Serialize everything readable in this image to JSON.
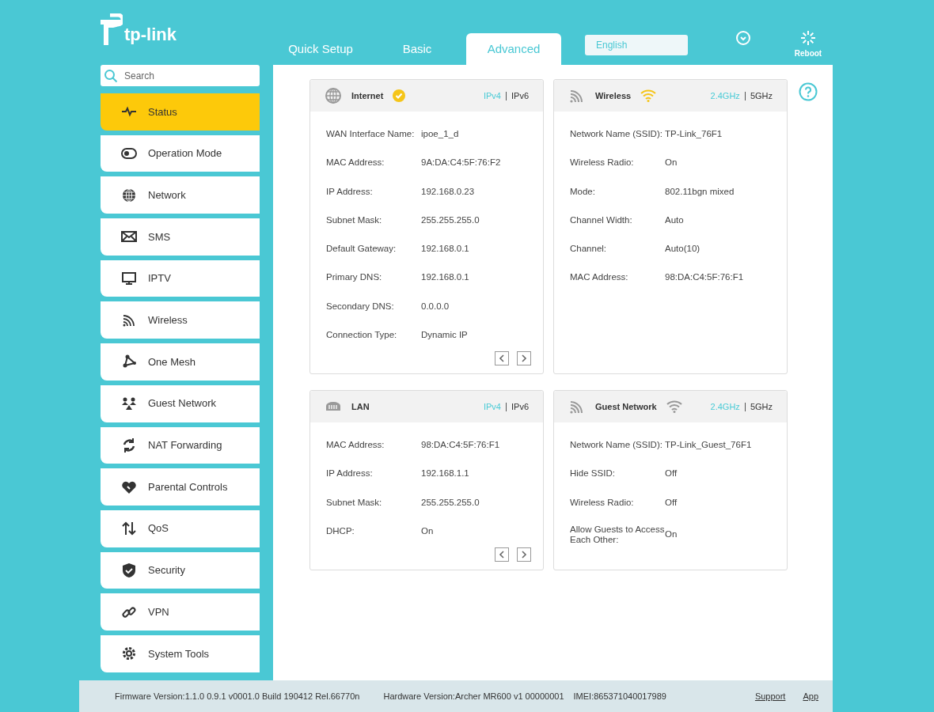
{
  "logo": {
    "text": "tp-link"
  },
  "tabs": [
    {
      "label": "Quick Setup",
      "selected": false
    },
    {
      "label": "Basic",
      "selected": false
    },
    {
      "label": "Advanced",
      "selected": true
    }
  ],
  "language": {
    "value": "English"
  },
  "header_actions": [
    {
      "kind": "logout"
    },
    {
      "kind": "reboot",
      "label": "Reboot"
    }
  ],
  "search": {
    "placeholder": "Search"
  },
  "sidebar": {
    "items": [
      {
        "kind": "status",
        "label": "Status",
        "selected": true
      },
      {
        "kind": "mode",
        "label": "Operation Mode",
        "selected": false
      },
      {
        "kind": "globe",
        "label": "Network",
        "selected": false
      },
      {
        "kind": "mail",
        "label": "SMS",
        "selected": false
      },
      {
        "kind": "monitor",
        "label": "IPTV",
        "selected": false
      },
      {
        "kind": "wifi",
        "label": "Wireless",
        "selected": false
      },
      {
        "kind": "mesh",
        "label": "One Mesh",
        "selected": false
      },
      {
        "kind": "guests",
        "label": "Guest Network",
        "selected": false
      },
      {
        "kind": "nat",
        "label": "NAT Forwarding",
        "selected": false
      },
      {
        "kind": "heart",
        "label": "Parental Controls",
        "selected": false
      },
      {
        "kind": "qos",
        "label": "QoS",
        "selected": false
      },
      {
        "kind": "shield",
        "label": "Security",
        "selected": false
      },
      {
        "kind": "link",
        "label": "VPN",
        "selected": false
      },
      {
        "kind": "gear",
        "label": "System Tools",
        "selected": false
      }
    ]
  },
  "cards": [
    {
      "kind": "internet",
      "title": "Internet",
      "connected": true,
      "options": [
        {
          "label": "IPv4",
          "selected": true
        },
        {
          "label": "IPv6",
          "selected": false
        }
      ],
      "pager": true,
      "rows": [
        {
          "label": "WAN Interface Name:",
          "value": "ipoe_1_d"
        },
        {
          "label": "MAC Address:",
          "value": "9A:DA:C4:5F:76:F2"
        },
        {
          "label": "IP Address:",
          "value": "192.168.0.23"
        },
        {
          "label": "Subnet Mask:",
          "value": "255.255.255.0"
        },
        {
          "label": "Default Gateway:",
          "value": "192.168.0.1"
        },
        {
          "label": "Primary DNS:",
          "value": "192.168.0.1"
        },
        {
          "label": "Secondary DNS:",
          "value": "0.0.0.0"
        },
        {
          "label": "Connection Type:",
          "value": "Dynamic IP"
        }
      ]
    },
    {
      "kind": "wireless",
      "title": "Wireless",
      "wifi_on": true,
      "options": [
        {
          "label": "2.4GHz",
          "selected": true
        },
        {
          "label": "5GHz",
          "selected": false
        }
      ],
      "pager": false,
      "rows": [
        {
          "label": "Network Name (SSID):",
          "value": "TP-Link_76F1"
        },
        {
          "label": "Wireless Radio:",
          "value": "On"
        },
        {
          "label": "Mode:",
          "value": "802.11bgn mixed"
        },
        {
          "label": "Channel Width:",
          "value": "Auto"
        },
        {
          "label": "Channel:",
          "value": "Auto(10)"
        },
        {
          "label": "MAC Address:",
          "value": "98:DA:C4:5F:76:F1"
        }
      ]
    },
    {
      "kind": "lan",
      "title": "LAN",
      "options": [
        {
          "label": "IPv4",
          "selected": true
        },
        {
          "label": "IPv6",
          "selected": false
        }
      ],
      "pager": true,
      "rows": [
        {
          "label": "MAC Address:",
          "value": "98:DA:C4:5F:76:F1"
        },
        {
          "label": "IP Address:",
          "value": "192.168.1.1"
        },
        {
          "label": "Subnet Mask:",
          "value": "255.255.255.0"
        },
        {
          "label": "DHCP:",
          "value": "On"
        }
      ]
    },
    {
      "kind": "wireless",
      "title": "Guest Network",
      "wifi_on": false,
      "options": [
        {
          "label": "2.4GHz",
          "selected": true
        },
        {
          "label": "5GHz",
          "selected": false
        }
      ],
      "pager": false,
      "rows": [
        {
          "label": "Network Name (SSID):",
          "value": "TP-Link_Guest_76F1"
        },
        {
          "label": "Hide SSID:",
          "value": "Off"
        },
        {
          "label": "Wireless Radio:",
          "value": "Off"
        },
        {
          "label": "Allow Guests to Access Each Other:",
          "value": "On"
        }
      ]
    }
  ],
  "footer": {
    "firmware": "Firmware Version:1.1.0 0.9.1 v0001.0 Build 190412 Rel.66770n",
    "hardware": "Hardware Version:Archer MR600 v1 00000001",
    "imei": "IMEI:865371040017989",
    "links": [
      "Support",
      "App"
    ]
  }
}
